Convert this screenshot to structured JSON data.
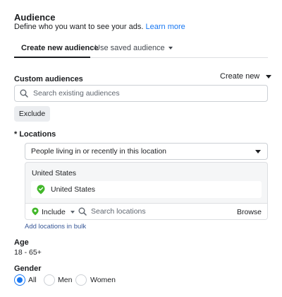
{
  "header": {
    "title": "Audience",
    "subtitle": "Define who you want to see your ads.",
    "learn_more": "Learn more"
  },
  "tabs": {
    "active": "Create new audience",
    "other": "Use saved audience"
  },
  "custom_audiences": {
    "label": "Custom audiences",
    "create_new": "Create new",
    "search_placeholder": "Search existing audiences",
    "exclude_label": "Exclude"
  },
  "locations": {
    "label": "* Locations",
    "dropdown_value": "People living in or recently in this location",
    "country_header": "United States",
    "selected_location": "United States",
    "include_label": "Include",
    "search_placeholder": "Search locations",
    "browse_label": "Browse",
    "bulk_link": "Add locations in bulk",
    "pin_color": "#42b72a"
  },
  "age": {
    "label": "Age",
    "value": "18 - 65+"
  },
  "gender": {
    "label": "Gender",
    "options": [
      "All",
      "Men",
      "Women"
    ],
    "selected": "All"
  },
  "colors": {
    "accent": "#1877f2",
    "link": "#385898"
  }
}
